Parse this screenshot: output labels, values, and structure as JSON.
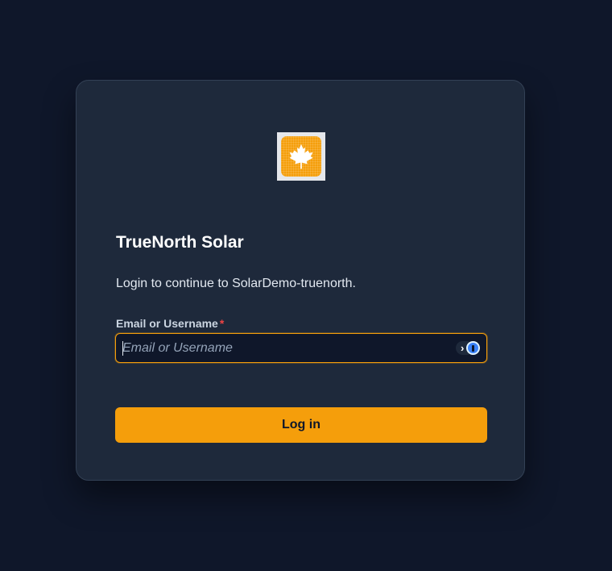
{
  "app": {
    "name": "TrueNorth Solar",
    "logo_icon": "maple-leaf-icon"
  },
  "login": {
    "subtitle": "Login to continue to SolarDemo-truenorth.",
    "field_label": "Email or Username",
    "required_mark": "*",
    "input_value": "",
    "input_placeholder": "Email or Username",
    "password_manager_icon": "password-manager-icon",
    "submit_label": "Log in"
  },
  "colors": {
    "background": "#0f172a",
    "card": "#1e293b",
    "accent": "#f59e0b",
    "required": "#ef4444"
  }
}
